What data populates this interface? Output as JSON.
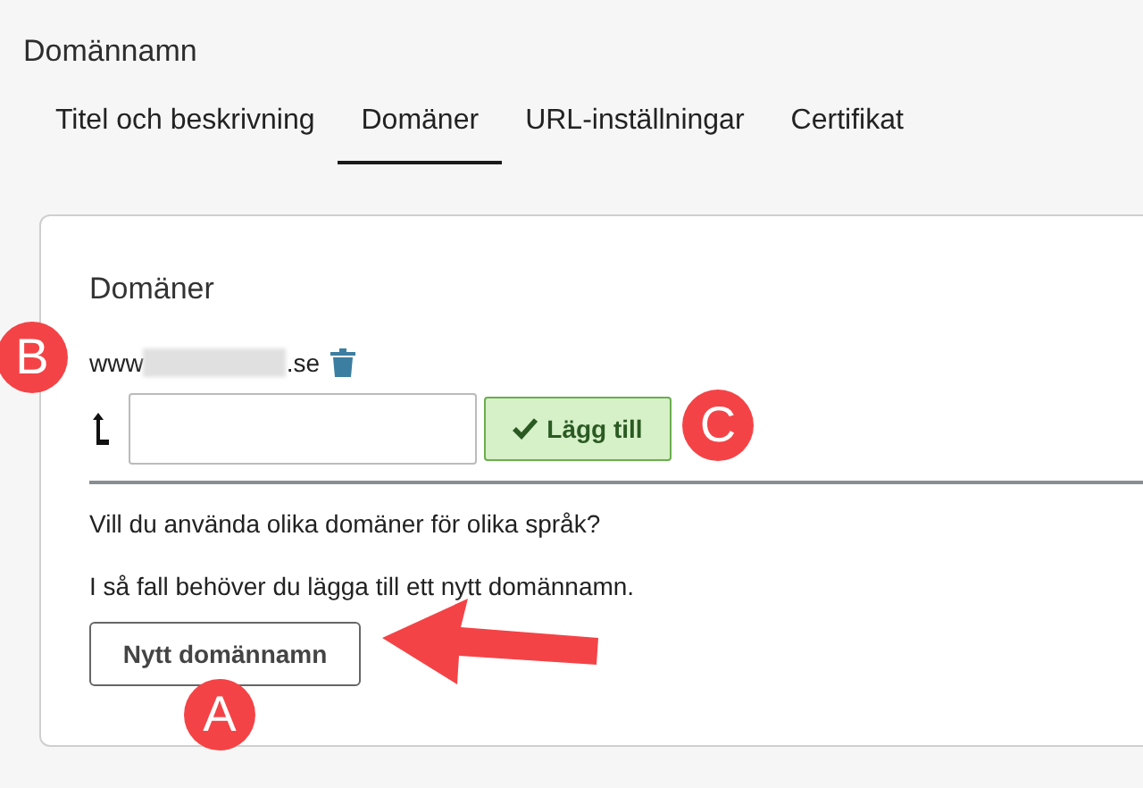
{
  "page_title": "Domännamn",
  "tabs": [
    {
      "label": "Titel och beskrivning",
      "selected": false
    },
    {
      "label": "Domäner",
      "selected": true
    },
    {
      "label": "URL-inställningar",
      "selected": false
    },
    {
      "label": "Certifikat",
      "selected": false
    }
  ],
  "card": {
    "heading": "Domäner",
    "domain": {
      "prefix": "www",
      "suffix": ".se",
      "redacted": true
    },
    "add_button": "Lägg till",
    "question": "Vill du använda olika domäner för olika språk?",
    "hint": "I så fall behöver du lägga till ett nytt domännamn.",
    "new_name_button": "Nytt domännamn"
  },
  "annotations": [
    {
      "label": "B"
    },
    {
      "label": "C"
    },
    {
      "label": "A"
    }
  ]
}
